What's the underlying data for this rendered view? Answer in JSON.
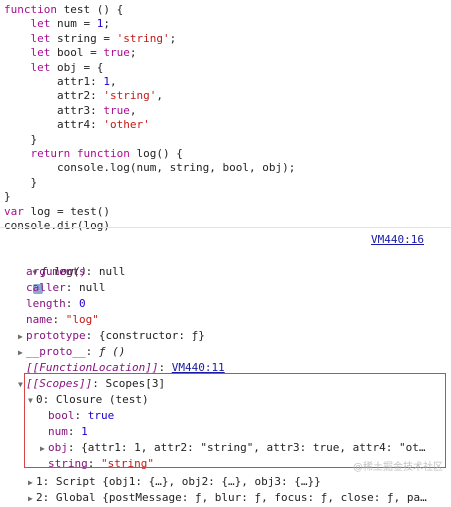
{
  "code_lines": [
    [
      {
        "t": "function",
        "c": "kw"
      },
      {
        "t": " test () {",
        "c": "pl"
      }
    ],
    [
      {
        "t": "    ",
        "c": "pl"
      },
      {
        "t": "let",
        "c": "kw"
      },
      {
        "t": " num = ",
        "c": "pl"
      },
      {
        "t": "1",
        "c": "num"
      },
      {
        "t": ";",
        "c": "pl"
      }
    ],
    [
      {
        "t": "    ",
        "c": "pl"
      },
      {
        "t": "let",
        "c": "kw"
      },
      {
        "t": " string = ",
        "c": "pl"
      },
      {
        "t": "'string'",
        "c": "str"
      },
      {
        "t": ";",
        "c": "pl"
      }
    ],
    [
      {
        "t": "    ",
        "c": "pl"
      },
      {
        "t": "let",
        "c": "kw"
      },
      {
        "t": " bool = ",
        "c": "pl"
      },
      {
        "t": "true",
        "c": "kw"
      },
      {
        "t": ";",
        "c": "pl"
      }
    ],
    [
      {
        "t": "    ",
        "c": "pl"
      },
      {
        "t": "let",
        "c": "kw"
      },
      {
        "t": " obj = {",
        "c": "pl"
      }
    ],
    [
      {
        "t": "        attr1: ",
        "c": "pl"
      },
      {
        "t": "1",
        "c": "num"
      },
      {
        "t": ",",
        "c": "pl"
      }
    ],
    [
      {
        "t": "        attr2: ",
        "c": "pl"
      },
      {
        "t": "'string'",
        "c": "str"
      },
      {
        "t": ",",
        "c": "pl"
      }
    ],
    [
      {
        "t": "        attr3: ",
        "c": "pl"
      },
      {
        "t": "true",
        "c": "kw"
      },
      {
        "t": ",",
        "c": "pl"
      }
    ],
    [
      {
        "t": "        attr4: ",
        "c": "pl"
      },
      {
        "t": "'other'",
        "c": "str"
      }
    ],
    [
      {
        "t": "    }",
        "c": "pl"
      }
    ],
    [
      {
        "t": "    ",
        "c": "pl"
      },
      {
        "t": "return",
        "c": "kw"
      },
      {
        "t": " ",
        "c": "pl"
      },
      {
        "t": "function",
        "c": "kw"
      },
      {
        "t": " log() {",
        "c": "pl"
      }
    ],
    [
      {
        "t": "        console.log(num, string, bool, obj);",
        "c": "pl"
      }
    ],
    [
      {
        "t": "    }",
        "c": "pl"
      }
    ],
    [
      {
        "t": "}",
        "c": "pl"
      }
    ],
    [
      {
        "t": "var",
        "c": "kw"
      },
      {
        "t": " log = test()",
        "c": "pl"
      }
    ],
    [
      {
        "t": "console.dir(log)",
        "c": "pl"
      }
    ]
  ],
  "source_link": "VM440:16",
  "tree": {
    "root_arrow": "▼",
    "root_label": "ƒ log()",
    "root_info": "i",
    "rows": [
      {
        "key": "arguments",
        "sep": ": ",
        "val": "null",
        "vc": "plain"
      },
      {
        "key": "caller",
        "sep": ": ",
        "val": "null",
        "vc": "plain"
      },
      {
        "key": "length",
        "sep": ": ",
        "val": "0",
        "vc": "num"
      },
      {
        "key": "name",
        "sep": ": ",
        "val": "\"log\"",
        "vc": "str"
      },
      {
        "arrow": "▶",
        "key": "prototype",
        "sep": ": ",
        "val": "{constructor: ƒ}",
        "vc": "plain"
      },
      {
        "arrow": "▶",
        "key": "__proto__",
        "sep": ": ",
        "val": "ƒ ()",
        "vc": "ital"
      },
      {
        "key": "[[FunctionLocation]]",
        "sep": ": ",
        "val": "VM440:11",
        "vc": "link"
      },
      {
        "arrow": "▼",
        "key": "[[Scopes]]",
        "sep": ": ",
        "val": "Scopes[3]",
        "vc": "plain"
      }
    ],
    "closure": {
      "arrow": "▼",
      "label": "0: Closure (test)",
      "items": [
        {
          "key": "bool",
          "sep": ": ",
          "val": "true",
          "vc": "kw"
        },
        {
          "key": "num",
          "sep": ": ",
          "val": "1",
          "vc": "num"
        },
        {
          "arrow": "▶",
          "key": "obj",
          "sep": ": ",
          "val": "{attr1: 1, attr2: \"string\", attr3: true, attr4: \"ot…",
          "vc": "plain"
        },
        {
          "key": "string",
          "sep": ": ",
          "val": "\"string\"",
          "vc": "str"
        }
      ]
    },
    "other_scopes": [
      {
        "arrow": "▶",
        "label": "1: Script {obj1: {…}, obj2: {…}, obj3: {…}}"
      },
      {
        "arrow": "▶",
        "label": "2: Global {postMessage: ƒ, blur: ƒ, focus: ƒ, close: ƒ, pa…"
      }
    ]
  },
  "watermark": "@稀土掘金技术社区",
  "colors": {
    "highlight_border": "#d94545",
    "link": "#1a1aa6",
    "keyword": "#aa0d91",
    "string": "#c41a16",
    "number": "#1c00cf"
  }
}
